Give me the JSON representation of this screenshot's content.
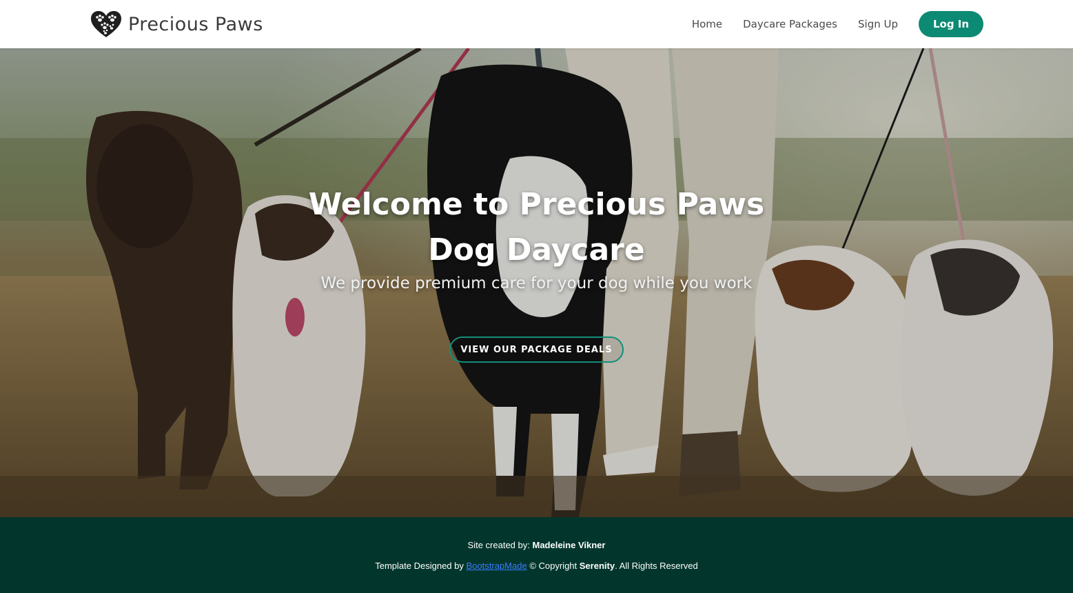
{
  "header": {
    "brand_name": "Precious Paws",
    "nav": {
      "home": "Home",
      "packages": "Daycare Packages",
      "signup": "Sign Up",
      "login": "Log In"
    }
  },
  "hero": {
    "title_line1": "Welcome to Precious Paws",
    "title_line2": "Dog Daycare",
    "subtitle": "We provide premium care for your dog while you work",
    "cta_label": "VIEW OUR PACKAGE DEALS"
  },
  "footer": {
    "credit_prefix": "Site created by:",
    "credit_name": "Madeleine Vikner",
    "template_prefix": "Template Designed by",
    "template_link": "BootstrapMade",
    "copyright_prefix": "© Copyright",
    "copyright_name": "Serenity",
    "copyright_suffix": ". All Rights Reserved"
  },
  "colors": {
    "accent": "#0d8a73",
    "footer_bg": "#02362c",
    "link": "#3b7bff"
  }
}
